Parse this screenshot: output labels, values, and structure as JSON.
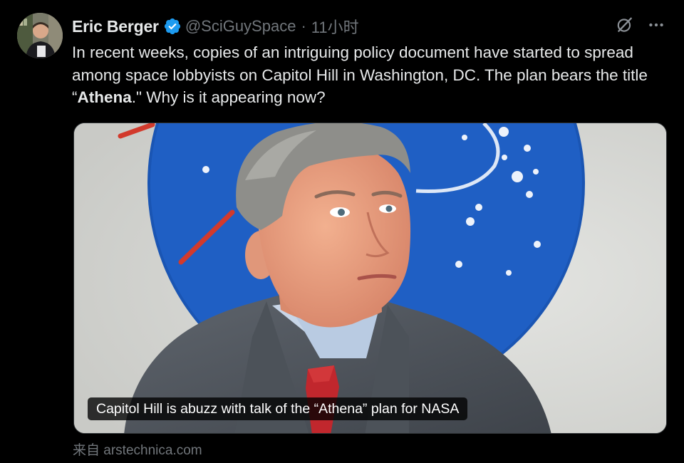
{
  "tweet": {
    "display_name": "Eric Berger",
    "handle": "@SciGuySpace",
    "separator": "·",
    "time": "11小时",
    "text_before": "In recent weeks, copies of an intriguing policy document have started to spread among space lobbyists on Capitol Hill in Washington, DC. The plan bears the title “",
    "text_bold": "Athena",
    "text_after": ".\" Why is it appearing now?",
    "verified": true
  },
  "card": {
    "caption": "Capitol Hill is abuzz with talk of the “Athena” plan for NASA",
    "source": "来自 arstechnica.com"
  },
  "icons": {
    "verified": "verified-badge-icon",
    "grok": "grok-icon",
    "more": "more-icon"
  },
  "colors": {
    "background": "#000000",
    "text_primary": "#e7e9ea",
    "text_secondary": "#71767b",
    "verified_blue": "#1d9bf0",
    "nasa_blue": "#1f5fc4"
  }
}
